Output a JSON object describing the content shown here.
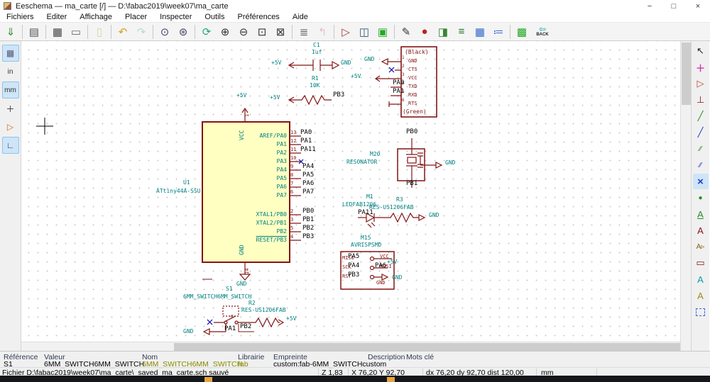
{
  "window": {
    "title": "Eeschema — ma_carte [/] — D:\\fabac2019\\week07\\ma_carte",
    "minimize": "−",
    "restore": "□",
    "close": "×"
  },
  "menu": {
    "items": [
      "Fichiers",
      "Editer",
      "Affichage",
      "Placer",
      "Inspecter",
      "Outils",
      "Préférences",
      "Aide"
    ]
  },
  "toolbar": {
    "back_label": "BACK",
    "items": [
      {
        "name": "save",
        "glyph": "⇓"
      },
      {
        "name": "page-settings",
        "glyph": "▤"
      },
      {
        "name": "print",
        "glyph": "▦"
      },
      {
        "name": "plot",
        "glyph": "▭"
      },
      {
        "name": "paste",
        "glyph": "▯"
      },
      {
        "name": "undo",
        "glyph": "↶"
      },
      {
        "name": "redo",
        "glyph": "↷"
      },
      {
        "name": "find",
        "glyph": "⊙"
      },
      {
        "name": "find-replace",
        "glyph": "⊛"
      },
      {
        "name": "redraw-view",
        "glyph": "⟳"
      },
      {
        "name": "zoom-in",
        "glyph": "⊕"
      },
      {
        "name": "zoom-out",
        "glyph": "⊖"
      },
      {
        "name": "zoom-fit",
        "glyph": "⊡"
      },
      {
        "name": "zoom-selection",
        "glyph": "⊠"
      },
      {
        "name": "hierarchy-navigator",
        "glyph": "≣"
      },
      {
        "name": "leave-sheet",
        "glyph": "↰"
      },
      {
        "name": "symbol-editor",
        "glyph": "▷"
      },
      {
        "name": "symbol-browser",
        "glyph": "◫"
      },
      {
        "name": "footprint-editor",
        "glyph": "▣"
      },
      {
        "name": "annotate",
        "glyph": "✎"
      },
      {
        "name": "erc",
        "glyph": "●"
      },
      {
        "name": "assign-footprints",
        "glyph": "◨"
      },
      {
        "name": "generate-netlist",
        "glyph": "≡"
      },
      {
        "name": "symbol-fields-table",
        "glyph": "▦"
      },
      {
        "name": "bom",
        "glyph": "≔"
      },
      {
        "name": "pcbnew",
        "glyph": "▩"
      },
      {
        "name": "back",
        "glyph": "⇦"
      }
    ]
  },
  "left_toolbar": {
    "items": [
      {
        "name": "grid-toggle",
        "glyph": "▦"
      },
      {
        "name": "units-inches",
        "glyph": "in"
      },
      {
        "name": "units-mm",
        "glyph": "mm"
      },
      {
        "name": "cursor-shape",
        "glyph": "＋"
      },
      {
        "name": "show-hidden-pins",
        "glyph": "▷"
      },
      {
        "name": "orthogonal-wires",
        "glyph": "∟"
      }
    ]
  },
  "right_toolbar": {
    "items": [
      {
        "name": "select-tool",
        "glyph": "↖"
      },
      {
        "name": "highlight-net",
        "glyph": "＋"
      },
      {
        "name": "place-symbol",
        "glyph": "▷"
      },
      {
        "name": "place-power-port",
        "glyph": "⊥"
      },
      {
        "name": "place-wire",
        "glyph": "╱"
      },
      {
        "name": "place-bus",
        "glyph": "╱"
      },
      {
        "name": "wire-to-bus-entry",
        "glyph": "∕∕"
      },
      {
        "name": "bus-to-bus-entry",
        "glyph": "∕∕"
      },
      {
        "name": "no-connect-flag",
        "glyph": "×"
      },
      {
        "name": "place-junction",
        "glyph": "●"
      },
      {
        "name": "net-label",
        "glyph": "A"
      },
      {
        "name": "global-label",
        "glyph": "A"
      },
      {
        "name": "hierarchical-label",
        "glyph": "A▹"
      },
      {
        "name": "hierarchical-sheet",
        "glyph": "▭"
      },
      {
        "name": "import-sheet-pin",
        "glyph": "A"
      },
      {
        "name": "place-text",
        "glyph": "A"
      },
      {
        "name": "selection-rect",
        "glyph": ""
      }
    ]
  },
  "sch": {
    "p5v": "+5V",
    "gnd": "GND",
    "u1": {
      "ref": "U1",
      "value": "ATtiny44A-SSU",
      "vcc": "VCC",
      "gnd_pin": "GND",
      "pin1": "1",
      "pin14": "14",
      "pa_names": [
        "AREF/PA0",
        "PA1",
        "PA2",
        "PA3",
        "PA4",
        "PA5",
        "PA6",
        "PA7"
      ],
      "pa_nums": [
        "13",
        "12",
        "11",
        "10",
        "9",
        "8",
        "7",
        "6"
      ],
      "pa_nets": [
        "PA0",
        "PA1",
        "PA11",
        "",
        "PA4",
        "PA5",
        "PA6",
        "PA7"
      ],
      "pb_names": [
        "XTAL1/PB0",
        "XTAL2/PB1",
        "PB2",
        "RESET/PB3"
      ],
      "pb_nums": [
        "2",
        "3",
        "5",
        "4"
      ],
      "pb_nets": [
        "PB0",
        "PB1",
        "PB2",
        "PB3"
      ]
    },
    "c1": {
      "ref": "C1",
      "value": "1uf"
    },
    "r1": {
      "ref": "R1",
      "value": "10K",
      "net": "PB3"
    },
    "ftdi": {
      "top": "(Black)",
      "bottom": "(Green)",
      "pins": [
        "GND",
        "CTS",
        "VCC",
        "TXD",
        "RXD",
        "RTS"
      ],
      "nums": [
        "1",
        "2",
        "3",
        "4",
        "5",
        "6"
      ],
      "net_txd": "PA0",
      "net_rxd": "PA1"
    },
    "res": {
      "ref": "M20",
      "value": "RESONATOR",
      "net_top": "PB0",
      "net_bottom": "PB1"
    },
    "led": {
      "ref": "M1",
      "value": "LEDFAB1206",
      "net": "PA11"
    },
    "r3": {
      "ref": "R3",
      "value": "RES-US1206FAB"
    },
    "isp": {
      "ref": "M15",
      "value": "AVRISPSMD",
      "pin_miso": "MISO",
      "pin_sck": "SCK",
      "pin_rst": "RST",
      "pin_vcc": "VCC",
      "pin_mosi": "MOSI",
      "pin_gnd": "GND",
      "net_miso": "PA5",
      "net_sck": "PA4",
      "net_rst": "PB3",
      "net_mosi": "PA6"
    },
    "s1": {
      "ref": "S1",
      "value": "6MM_SWITCH6MM_SWITCH",
      "pin_s": "S",
      "net_a": "PA1",
      "net_b": "PB2"
    },
    "r2": {
      "ref": "R2",
      "value": "RES-US1206FAB"
    }
  },
  "statusbar": {
    "headers": [
      "Référence",
      "Valeur",
      "Nom",
      "Librairie",
      "Empreinte",
      "Description",
      "Mots clé"
    ],
    "reference": "S1",
    "valeur": "6MM_SWITCH6MM_SWITCH",
    "nom": "6MM_SWITCH6MM_SWITCH",
    "librairie": "fab",
    "empreinte": "custom:fab-6MM_SWITCHcustom",
    "file_message": "Fichier D:\\fabac2019\\week07\\ma_carte\\_saved_ma_carte.sch sauvé",
    "zoom": "Z 1,83",
    "pos": "X 76,20 Y 92,70",
    "delta": "dx 76,20 dy 92,70 dist 120,00",
    "units": "mm"
  }
}
